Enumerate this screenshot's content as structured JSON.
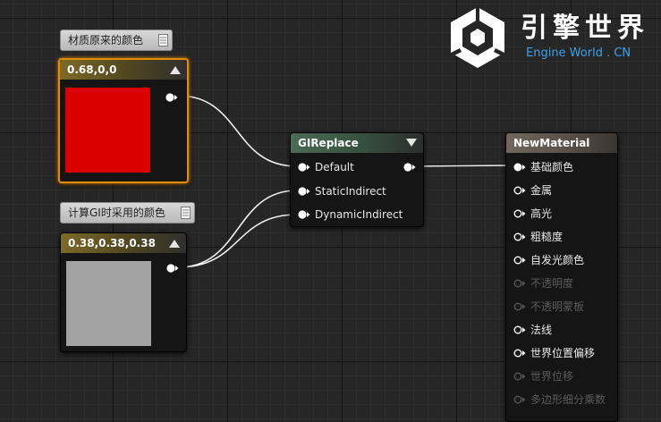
{
  "comments": {
    "original": "材质原来的颜色",
    "gi": "计算GI时采用的颜色"
  },
  "node_red": {
    "title": "0.68,0,0",
    "color": "#db0000"
  },
  "node_gray": {
    "title": "0.38,0.38,0.38",
    "color": "#a3a3a3"
  },
  "node_gi": {
    "title": "GIReplace",
    "input_default": "Default",
    "input_static": "StaticIndirect",
    "input_dynamic": "DynamicIndirect"
  },
  "node_material": {
    "title": "NewMaterial",
    "pins": [
      {
        "label": "基础颜色",
        "active": true
      },
      {
        "label": "金属",
        "active": true
      },
      {
        "label": "高光",
        "active": true
      },
      {
        "label": "粗糙度",
        "active": true
      },
      {
        "label": "自发光颜色",
        "active": true
      },
      {
        "label": "不透明度",
        "active": false
      },
      {
        "label": "不透明蒙板",
        "active": false
      },
      {
        "label": "法线",
        "active": true
      },
      {
        "label": "世界位置偏移",
        "active": true
      },
      {
        "label": "世界位移",
        "active": false
      },
      {
        "label": "多边形细分乘数",
        "active": false
      }
    ]
  },
  "logo": {
    "cn": "引擎世界",
    "en": "Engine World . CN"
  }
}
